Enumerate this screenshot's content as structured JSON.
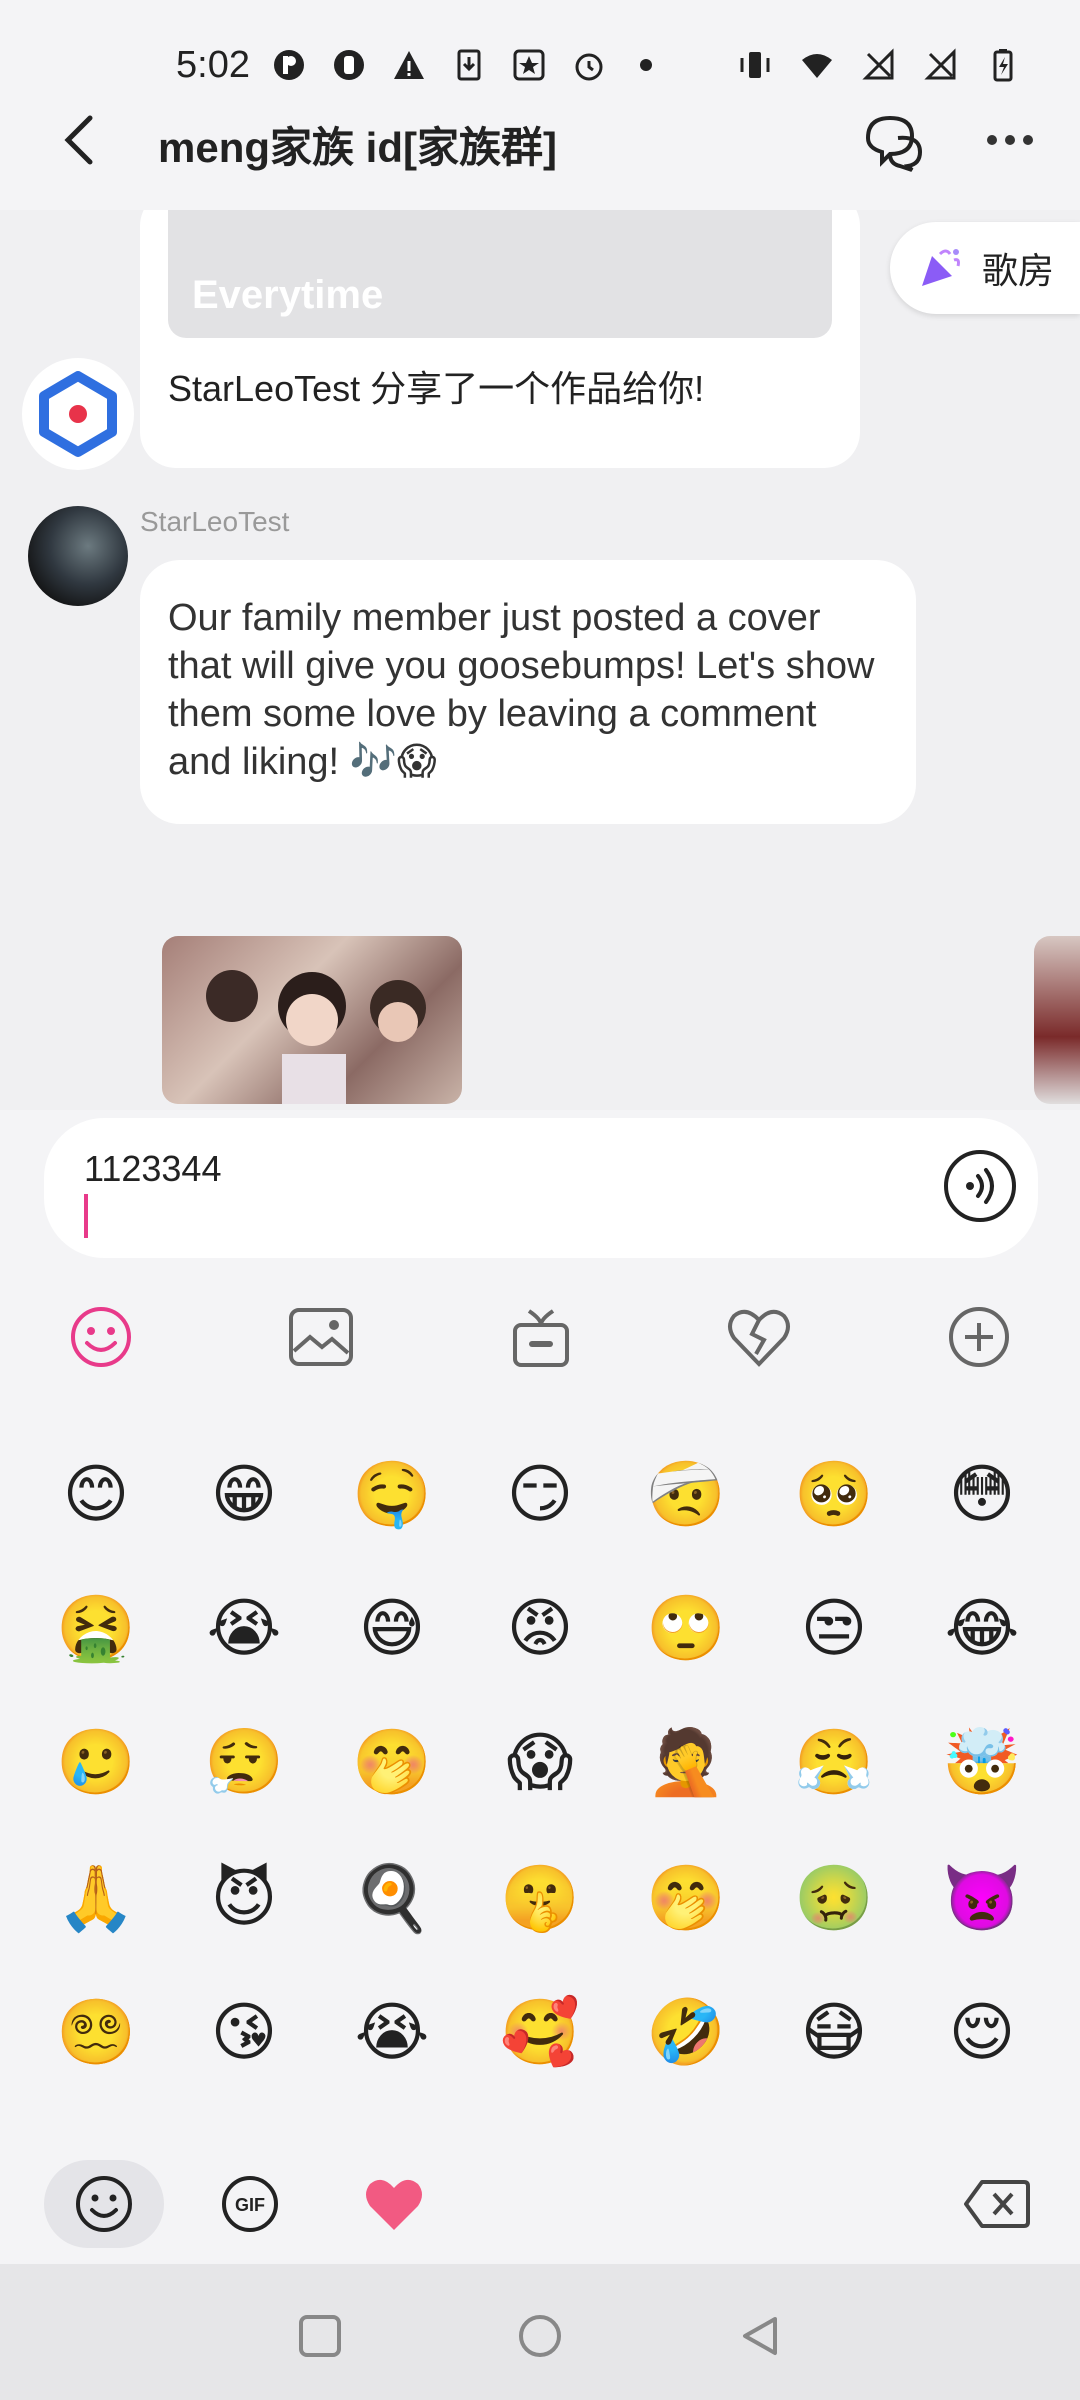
{
  "status_bar": {
    "time": "5:02",
    "left_icons": [
      "p-badge-icon",
      "shield-icon",
      "warning-icon",
      "download-icon",
      "star-app-icon",
      "alarm-icon",
      "dot-icon"
    ],
    "right_icons": [
      "vibrate-icon",
      "wifi-icon",
      "no-signal-icon",
      "no-signal-icon",
      "battery-charging-icon"
    ]
  },
  "header": {
    "title": "meng家族 id[家族群]"
  },
  "messages": {
    "share_card": {
      "image_title": "Everytime",
      "text": "StarLeoTest 分享了一个作品给你!"
    },
    "room_pill_label": "歌房",
    "sender_name": "StarLeoTest",
    "message_text": "Our family member just posted a cover that will give you goosebumps! Let's show them some love by leaving a comment and liking! 🎶😱"
  },
  "input": {
    "value": "1123344"
  },
  "toolbar": {
    "items": [
      "emoji-icon",
      "image-icon",
      "gift-icon",
      "heart-broken-icon",
      "plus-icon"
    ],
    "accent": "#e83a8a"
  },
  "emojis": [
    [
      "😊",
      "😁",
      "🤤",
      "😏",
      "🤕",
      "🥺",
      "😳"
    ],
    [
      "🤮",
      "😭",
      "😅",
      "😡",
      "🙄",
      "😒",
      "😂"
    ],
    [
      "🥲",
      "😮‍💨",
      "🤭",
      "😱",
      "🤦",
      "😤",
      "🤯"
    ],
    [
      "🙏",
      "😈",
      "🍳",
      "🤫",
      "🤭",
      "🤢",
      "👿"
    ],
    [
      "😵‍💫",
      "😘",
      "😭",
      "🥰",
      "🤣",
      "😷",
      "😌"
    ]
  ],
  "emoji_tabs": [
    "smiley-tab-icon",
    "gif-tab-icon",
    "heart-tab-icon"
  ],
  "emoji_tab_gif_label": "GIF"
}
